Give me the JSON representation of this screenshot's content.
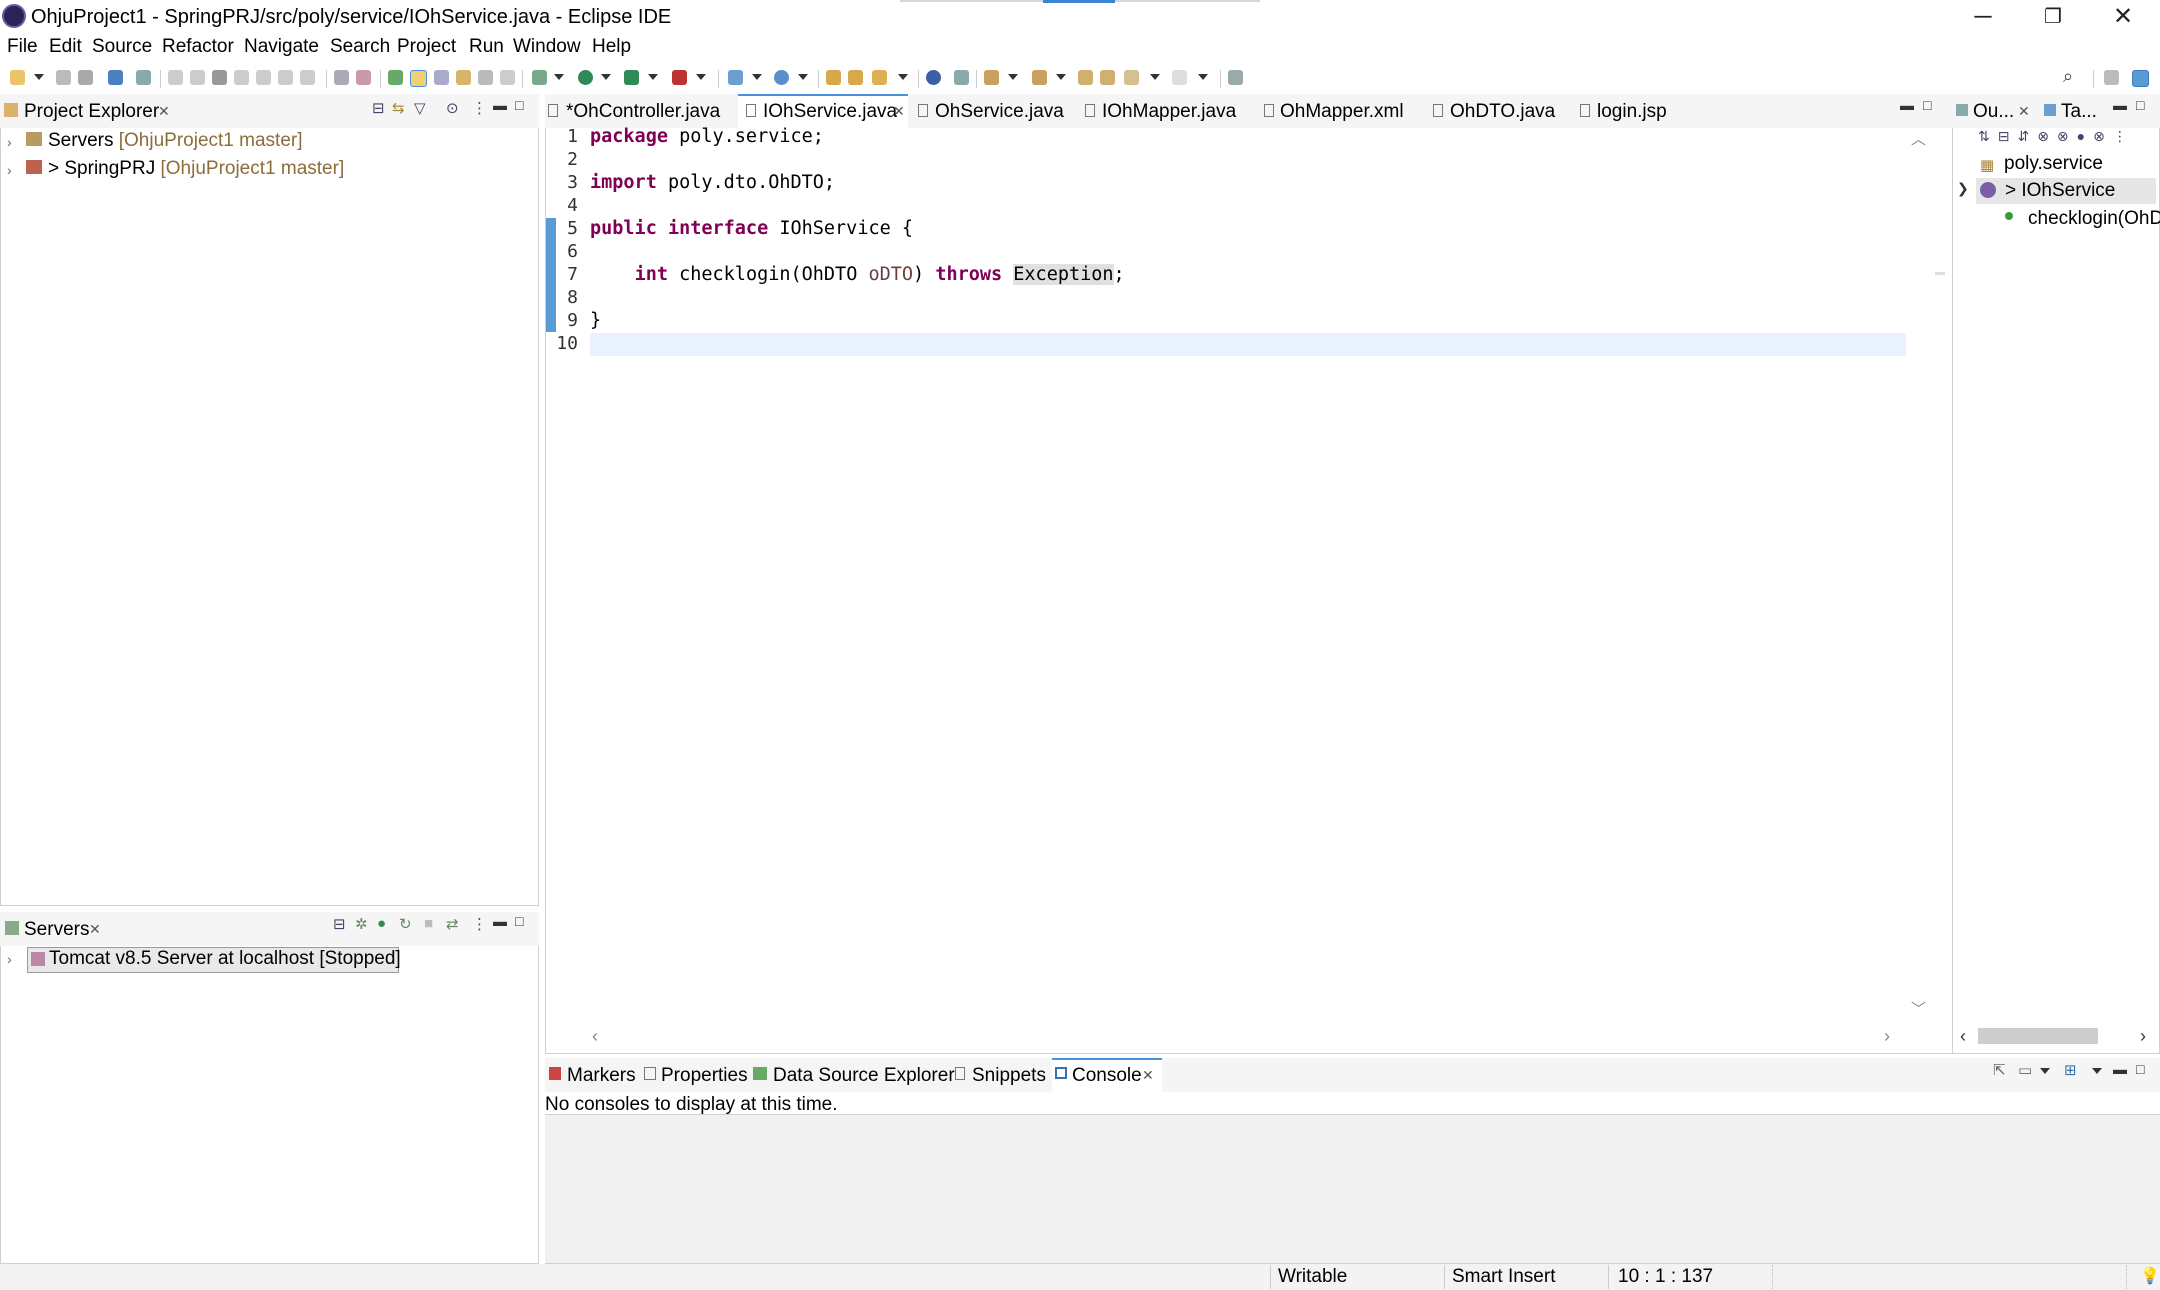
{
  "window": {
    "title": "OhjuProject1 - SpringPRJ/src/poly/service/IOhService.java - Eclipse IDE",
    "minimize_glyph": "─",
    "restore_glyph": "❐",
    "close_glyph": "✕"
  },
  "menu": [
    "File",
    "Edit",
    "Source",
    "Refactor",
    "Navigate",
    "Search",
    "Project",
    "Run",
    "Window",
    "Help"
  ],
  "project_explorer": {
    "title": "Project Explorer",
    "items": [
      {
        "name": "Servers",
        "branch": "[OhjuProject1 master]"
      },
      {
        "name": "> SpringPRJ",
        "branch": "[OhjuProject1 master]"
      }
    ]
  },
  "servers_view": {
    "title": "Servers",
    "items": [
      {
        "label": "Tomcat v8.5 Server at localhost  [Stopped]"
      }
    ]
  },
  "editor": {
    "tabs": [
      {
        "label": "*OhController.java",
        "icon": "java-file-icon"
      },
      {
        "label": "IOhService.java",
        "icon": "java-file-icon",
        "active": true
      },
      {
        "label": "OhService.java",
        "icon": "java-file-icon"
      },
      {
        "label": "IOhMapper.java",
        "icon": "java-file-icon"
      },
      {
        "label": "OhMapper.xml",
        "icon": "xml-file-icon"
      },
      {
        "label": "OhDTO.java",
        "icon": "java-file-icon"
      },
      {
        "label": "login.jsp",
        "icon": "jsp-file-icon"
      }
    ],
    "lines": [
      {
        "n": "1",
        "tokens": [
          {
            "t": "package",
            "c": "kw"
          },
          {
            "t": " poly.service;"
          }
        ]
      },
      {
        "n": "2",
        "tokens": []
      },
      {
        "n": "3",
        "tokens": [
          {
            "t": "import",
            "c": "kw"
          },
          {
            "t": " poly.dto.OhDTO;"
          }
        ]
      },
      {
        "n": "4",
        "tokens": []
      },
      {
        "n": "5",
        "tokens": [
          {
            "t": "public",
            "c": "kw"
          },
          {
            "t": " "
          },
          {
            "t": "interface",
            "c": "kw"
          },
          {
            "t": " IOhService {"
          }
        ]
      },
      {
        "n": "6",
        "tokens": []
      },
      {
        "n": "7",
        "tokens": [
          {
            "t": "    "
          },
          {
            "t": "int",
            "c": "kw"
          },
          {
            "t": " checklogin(OhDTO "
          },
          {
            "t": "oDTO",
            "c": "param"
          },
          {
            "t": ") "
          },
          {
            "t": "throws",
            "c": "kw"
          },
          {
            "t": " "
          },
          {
            "t": "Exception",
            "c": "hl"
          },
          {
            "t": ";"
          }
        ]
      },
      {
        "n": "8",
        "tokens": []
      },
      {
        "n": "9",
        "tokens": [
          {
            "t": "}"
          }
        ]
      },
      {
        "n": "10",
        "tokens": []
      }
    ]
  },
  "outline": {
    "tab1": "Ou...",
    "tab2": "Ta...",
    "items": [
      {
        "label": "poly.service",
        "icon": "package-icon"
      },
      {
        "label": "> IOhService",
        "icon": "interface-icon"
      },
      {
        "label": "checklogin(OhD",
        "icon": "method-icon"
      }
    ]
  },
  "bottom_views": {
    "tabs": [
      {
        "label": "Markers",
        "icon": "markers-icon"
      },
      {
        "label": "Properties",
        "icon": "properties-icon"
      },
      {
        "label": "Data Source Explorer",
        "icon": "datasource-icon"
      },
      {
        "label": "Snippets",
        "icon": "snippets-icon"
      },
      {
        "label": "Console",
        "icon": "console-icon",
        "active": true
      }
    ],
    "console_message": "No consoles to display at this time."
  },
  "status_bar": {
    "writable": "Writable",
    "insert_mode": "Smart Insert",
    "position": "10 : 1 : 137"
  },
  "colors": {
    "keyword": "#7f0055",
    "branch_label": "#8b6d3a",
    "current_line": "#e8f2fe",
    "change_bar": "#5b9bd5"
  }
}
